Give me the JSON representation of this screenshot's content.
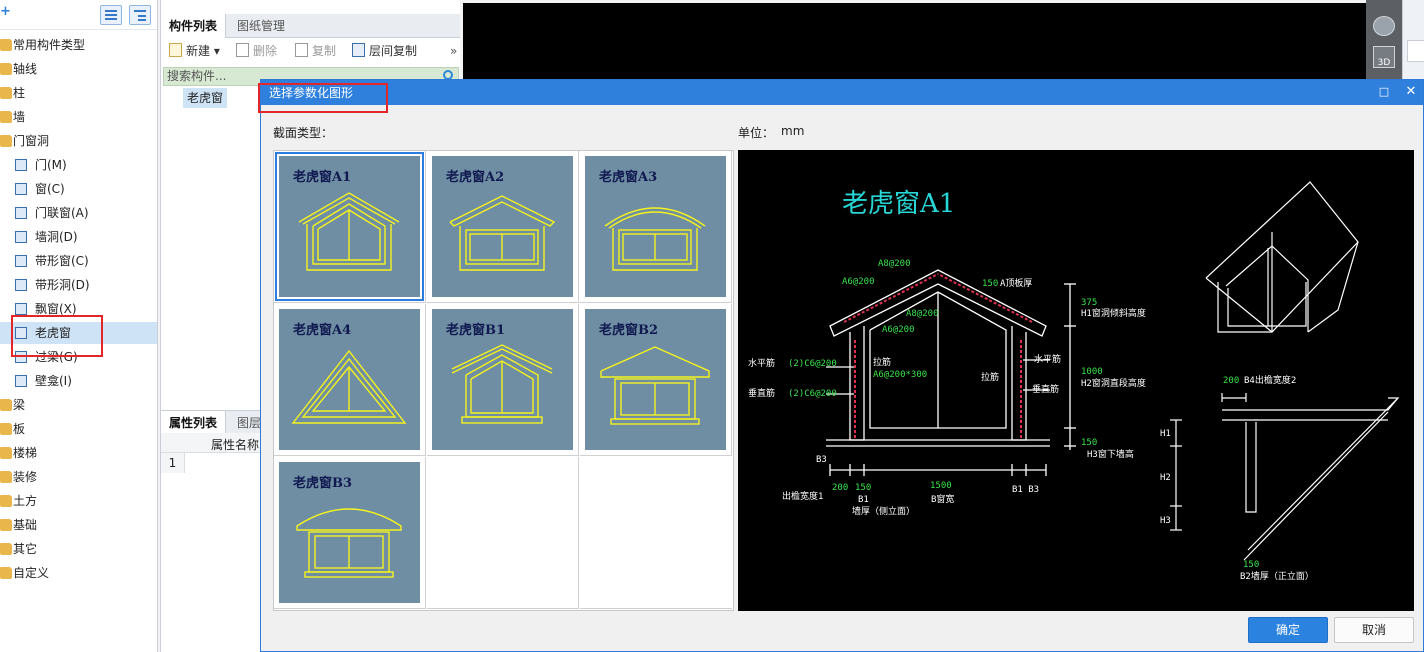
{
  "tree": {
    "items": [
      {
        "label": "常用构件类型",
        "kind": "folder"
      },
      {
        "label": "轴线",
        "kind": "folder"
      },
      {
        "label": "柱",
        "kind": "folder"
      },
      {
        "label": "墙",
        "kind": "folder"
      },
      {
        "label": "门窗洞",
        "kind": "folder"
      },
      {
        "label": "门(M)",
        "kind": "leaf"
      },
      {
        "label": "窗(C)",
        "kind": "leaf"
      },
      {
        "label": "门联窗(A)",
        "kind": "leaf"
      },
      {
        "label": "墙洞(D)",
        "kind": "leaf"
      },
      {
        "label": "带形窗(C)",
        "kind": "leaf"
      },
      {
        "label": "带形洞(D)",
        "kind": "leaf"
      },
      {
        "label": "飘窗(X)",
        "kind": "leaf"
      },
      {
        "label": "老虎窗",
        "kind": "leaf",
        "selected": true
      },
      {
        "label": "过梁(G)",
        "kind": "leaf"
      },
      {
        "label": "壁龛(I)",
        "kind": "leaf"
      },
      {
        "label": "梁",
        "kind": "folder"
      },
      {
        "label": "板",
        "kind": "folder"
      },
      {
        "label": "楼梯",
        "kind": "folder"
      },
      {
        "label": "装修",
        "kind": "folder"
      },
      {
        "label": "土方",
        "kind": "folder"
      },
      {
        "label": "基础",
        "kind": "folder"
      },
      {
        "label": "其它",
        "kind": "folder"
      },
      {
        "label": "自定义",
        "kind": "folder"
      }
    ]
  },
  "component_panel": {
    "tab_list": "构件列表",
    "tab_drawings": "图纸管理",
    "new": "新建",
    "delete": "删除",
    "copy": "复制",
    "floor_copy": "层间复制",
    "search_placeholder": "搜索构件...",
    "item": "老虎窗",
    "props_tab": "属性列表",
    "props_tab2": "图层",
    "props_col": "属性名称",
    "props_row1": "1"
  },
  "dialog": {
    "title": "选择参数化图形",
    "section_label": "截面类型：",
    "unit_label": "单位：",
    "unit_value": "mm",
    "shapes": [
      "老虎窗A1",
      "老虎窗A2",
      "老虎窗A3",
      "老虎窗A4",
      "老虎窗B1",
      "老虎窗B2",
      "老虎窗B3"
    ],
    "selected_shape": "老虎窗A1",
    "ok": "确定",
    "cancel": "取消"
  },
  "preview": {
    "title": "老虎窗A1",
    "labels": {
      "a8_200_top": "A8@200",
      "a6_200_left": "A6@200",
      "a8_200_mid": "A8@200",
      "a6_200_mid": "A6@200",
      "t150": "150",
      "a_thick": "A顶板厚",
      "h375": "375",
      "h1": "H1窗洞倾斜高度",
      "h1000": "1000",
      "h2": "H2窗洞直段高度",
      "h150": "150",
      "h3": "H3窗下墙高",
      "horiz": "水平筋",
      "horiz_val": "(2)C6@200",
      "vert": "垂直筋",
      "vert_val": "(2)C6@200",
      "tie": "拉筋",
      "tie_val": "A6@200*300",
      "tie_r": "拉筋",
      "horiz_r": "水平筋",
      "vert_r": "垂直筋",
      "b3": "B3",
      "d200": "200",
      "d150": "150",
      "d1500": "1500",
      "b1": "B1",
      "b1b3": "B1 B3",
      "eave": "出檐宽度1",
      "wall": "墙厚（侧立面）",
      "b_width": "B窗宽",
      "b4_200": "200",
      "b4": "B4出檐宽度2",
      "H1": "H1",
      "H2": "H2",
      "H3": "H3",
      "s150": "150",
      "b2": "B2墙厚（正立面）"
    }
  }
}
